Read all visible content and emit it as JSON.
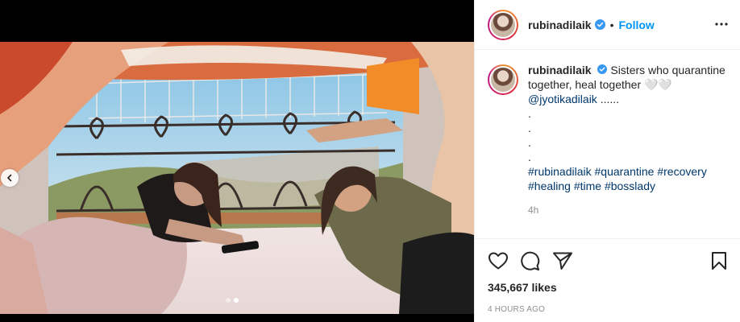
{
  "post": {
    "username": "rubinadilaik",
    "follow_label": "Follow",
    "separator": "•",
    "caption": {
      "text": "Sisters who quarantine together, heal together 🤍🤍",
      "mention": "@jyotikadilaik",
      "mention_suffix": " ......",
      "dots": [
        ".",
        ".",
        ".",
        "."
      ],
      "hashtags": [
        "#rubinadilaik",
        "#quarantine",
        "#recovery",
        "#healing",
        "#time",
        "#bosslady"
      ],
      "age": "4h"
    },
    "likes": "345,667 likes",
    "timestamp": "4 HOURS AGO",
    "carousel": {
      "slide_count": 2,
      "active_index": 1
    }
  },
  "icons": {
    "verified": "verified-badge-icon",
    "more": "more-options-icon",
    "heart": "heart-icon",
    "comment": "comment-icon",
    "share": "share-icon",
    "bookmark": "bookmark-icon",
    "prev": "chevron-left-icon"
  },
  "colors": {
    "accent": "#0095f6",
    "mention": "#00376b",
    "muted": "#8e8e8e",
    "verified": "#3897f0"
  }
}
